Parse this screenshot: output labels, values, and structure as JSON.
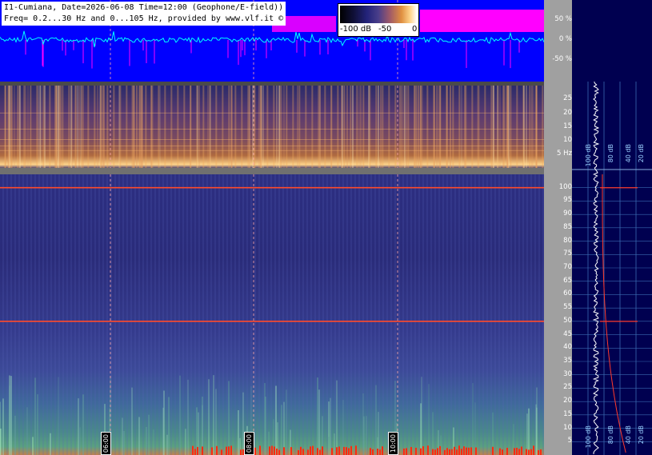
{
  "header": {
    "line1": "I1-Cumiana, Date=2026-06-08 Time=12:00 (Geophone/E-field))",
    "line2": "Freq= 0.2...30 Hz and 0...105 Hz, provided by www.vlf.it ©"
  },
  "colorbar": {
    "min_label": "-100 dB",
    "mid_label": "-50",
    "max_label": "0"
  },
  "colors": {
    "waveform_bg": "#0000ff",
    "signal": "#00ffff",
    "clip": "#ff00ff",
    "profile_bg": "#000050",
    "axis_bg": "#a0a0a0"
  },
  "time_markers": [
    "06:00",
    "08:00",
    "10:00"
  ],
  "profile_labels": {
    "a": "100 dB",
    "b": "80 dB",
    "c": "40 dB",
    "d": "20 dB"
  },
  "chart_data": [
    {
      "type": "line",
      "title": "",
      "ylabel": "",
      "ylim": [
        -100,
        100
      ],
      "y_ticks": [
        "50 %",
        "0 %",
        "-50 %"
      ]
    },
    {
      "type": "heatmap",
      "title": "",
      "ylim": [
        0.2,
        30
      ],
      "y_ticks": [
        "25",
        "20",
        "15",
        "10",
        "5 Hz"
      ],
      "time_markers": [
        "06:00",
        "08:00",
        "10:00"
      ]
    },
    {
      "type": "heatmap",
      "title": "",
      "ylim": [
        0,
        105
      ],
      "y_ticks": [
        "100",
        "95",
        "90",
        "85",
        "80",
        "75",
        "70",
        "65",
        "60",
        "55",
        "50",
        "45",
        "40",
        "35",
        "30",
        "25",
        "20",
        "15",
        "10",
        "5"
      ],
      "time_markers": [
        "06:00",
        "08:00",
        "10:00"
      ],
      "strong_lines_hz": [
        50,
        100
      ]
    }
  ]
}
